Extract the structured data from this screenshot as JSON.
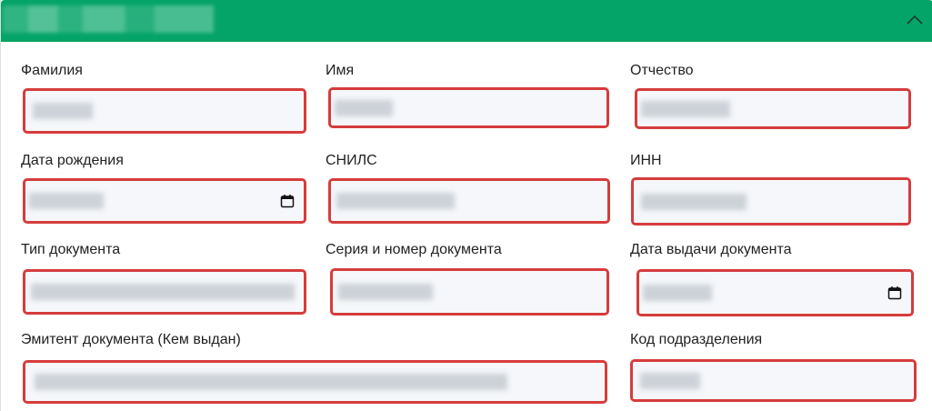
{
  "card": {
    "title": "",
    "collapse_icon": "chevron-up-icon"
  },
  "fields": {
    "last_name": {
      "label": "Фамилия",
      "value": ""
    },
    "first_name": {
      "label": "Имя",
      "value": ""
    },
    "patronymic": {
      "label": "Отчество",
      "value": ""
    },
    "birth_date": {
      "label": "Дата рождения",
      "value": "",
      "icon": "calendar-icon"
    },
    "snils": {
      "label": "СНИЛС",
      "value": ""
    },
    "inn": {
      "label": "ИНН",
      "value": ""
    },
    "doc_type": {
      "label": "Тип документа",
      "value": ""
    },
    "doc_number": {
      "label": "Серия и номер документа",
      "value": ""
    },
    "doc_issue_date": {
      "label": "Дата выдачи документа",
      "value": "",
      "icon": "calendar-icon"
    },
    "doc_issuer": {
      "label": "Эмитент документа (Кем выдан)",
      "value": ""
    },
    "division_code": {
      "label": "Код подразделения",
      "value": ""
    }
  },
  "colors": {
    "header_bg": "#04a468",
    "error_border": "#d63c3c",
    "input_bg": "#f5f7fa"
  }
}
